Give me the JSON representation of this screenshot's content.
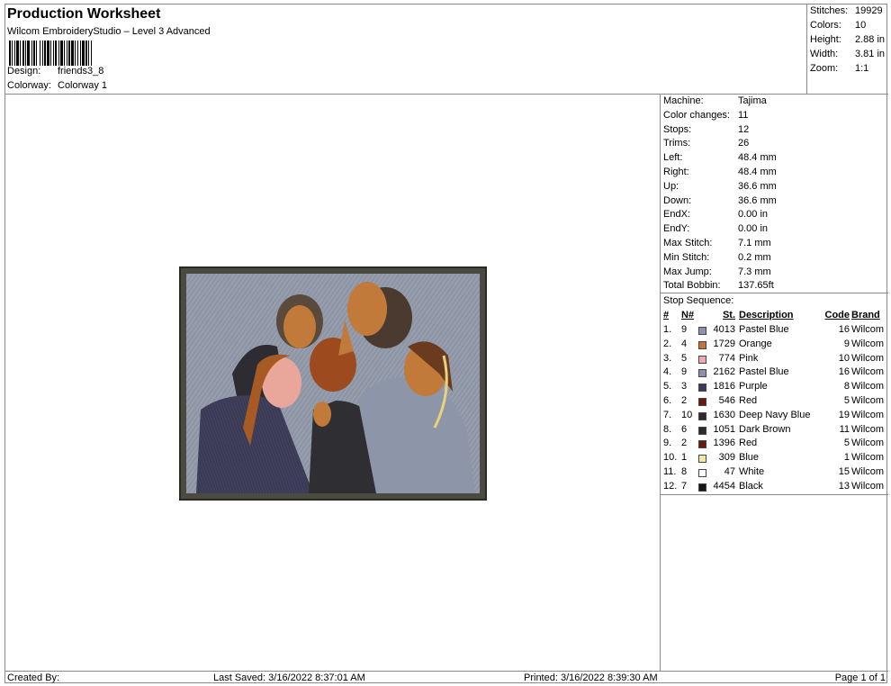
{
  "header": {
    "title": "Production Worksheet",
    "subtitle": "Wilcom EmbroideryStudio – Level 3 Advanced",
    "design_label": "Design:",
    "design_value": "friends3_8",
    "colorway_label": "Colorway:",
    "colorway_value": "Colorway 1"
  },
  "summary": [
    {
      "label": "Stitches:",
      "value": "19929"
    },
    {
      "label": "Colors:",
      "value": "10"
    },
    {
      "label": "Height:",
      "value": "2.88 in"
    },
    {
      "label": "Width:",
      "value": "3.81 in"
    },
    {
      "label": "Zoom:",
      "value": "1:1"
    }
  ],
  "machine_info": [
    {
      "label": "Machine:",
      "value": "Tajima"
    },
    {
      "label": "Color changes:",
      "value": "11"
    },
    {
      "label": "Stops:",
      "value": "12"
    },
    {
      "label": "Trims:",
      "value": "26"
    },
    {
      "label": "Left:",
      "value": "48.4 mm"
    },
    {
      "label": "Right:",
      "value": "48.4 mm"
    },
    {
      "label": "Up:",
      "value": "36.6 mm"
    },
    {
      "label": "Down:",
      "value": "36.6 mm"
    },
    {
      "label": "EndX:",
      "value": "0.00 in"
    },
    {
      "label": "EndY:",
      "value": "0.00 in"
    },
    {
      "label": "Max Stitch:",
      "value": "7.1 mm"
    },
    {
      "label": "Min Stitch:",
      "value": "0.2 mm"
    },
    {
      "label": "Max Jump:",
      "value": "7.3 mm"
    },
    {
      "label": "Total Bobbin:",
      "value": "137.65ft"
    }
  ],
  "stop_sequence": {
    "title": "Stop Sequence:",
    "columns": {
      "index": "#",
      "n": "N#",
      "st": "St.",
      "description": "Description",
      "code": "Code",
      "brand": "Brand"
    },
    "rows": [
      {
        "index": "1.",
        "n": "9",
        "color": "#8f8fb0",
        "st": "4013",
        "description": "Pastel Blue",
        "code": "16",
        "brand": "Wilcom"
      },
      {
        "index": "2.",
        "n": "4",
        "color": "#c4743a",
        "st": "1729",
        "description": "Orange",
        "code": "9",
        "brand": "Wilcom"
      },
      {
        "index": "3.",
        "n": "5",
        "color": "#f2a7b4",
        "st": "774",
        "description": "Pink",
        "code": "10",
        "brand": "Wilcom"
      },
      {
        "index": "4.",
        "n": "9",
        "color": "#8f8fb0",
        "st": "2162",
        "description": "Pastel Blue",
        "code": "16",
        "brand": "Wilcom"
      },
      {
        "index": "5.",
        "n": "3",
        "color": "#3c3a5c",
        "st": "1816",
        "description": "Purple",
        "code": "8",
        "brand": "Wilcom"
      },
      {
        "index": "6.",
        "n": "2",
        "color": "#6a1a0c",
        "st": "546",
        "description": "Red",
        "code": "5",
        "brand": "Wilcom"
      },
      {
        "index": "7.",
        "n": "10",
        "color": "#2b2b30",
        "st": "1630",
        "description": "Deep Navy Blue",
        "code": "19",
        "brand": "Wilcom"
      },
      {
        "index": "8.",
        "n": "6",
        "color": "#2e2a2a",
        "st": "1051",
        "description": "Dark Brown",
        "code": "11",
        "brand": "Wilcom"
      },
      {
        "index": "9.",
        "n": "2",
        "color": "#6a1a0c",
        "st": "1396",
        "description": "Red",
        "code": "5",
        "brand": "Wilcom"
      },
      {
        "index": "10.",
        "n": "1",
        "color": "#f3e7a8",
        "st": "309",
        "description": "Blue",
        "code": "1",
        "brand": "Wilcom"
      },
      {
        "index": "11.",
        "n": "8",
        "color": "#ffffff",
        "st": "47",
        "description": "White",
        "code": "15",
        "brand": "Wilcom"
      },
      {
        "index": "12.",
        "n": "7",
        "color": "#141414",
        "st": "4454",
        "description": "Black",
        "code": "13",
        "brand": "Wilcom"
      }
    ]
  },
  "footer": {
    "created_by": "Created By:",
    "last_saved": "Last Saved: 3/16/2022 8:37:01 AM",
    "printed": "Printed: 3/16/2022 8:39:30 AM",
    "page": "Page 1 of 1"
  },
  "colors": {
    "border": "#8a8a8a",
    "frame": "#4a4a40",
    "background_fill": "#8e96a6"
  }
}
